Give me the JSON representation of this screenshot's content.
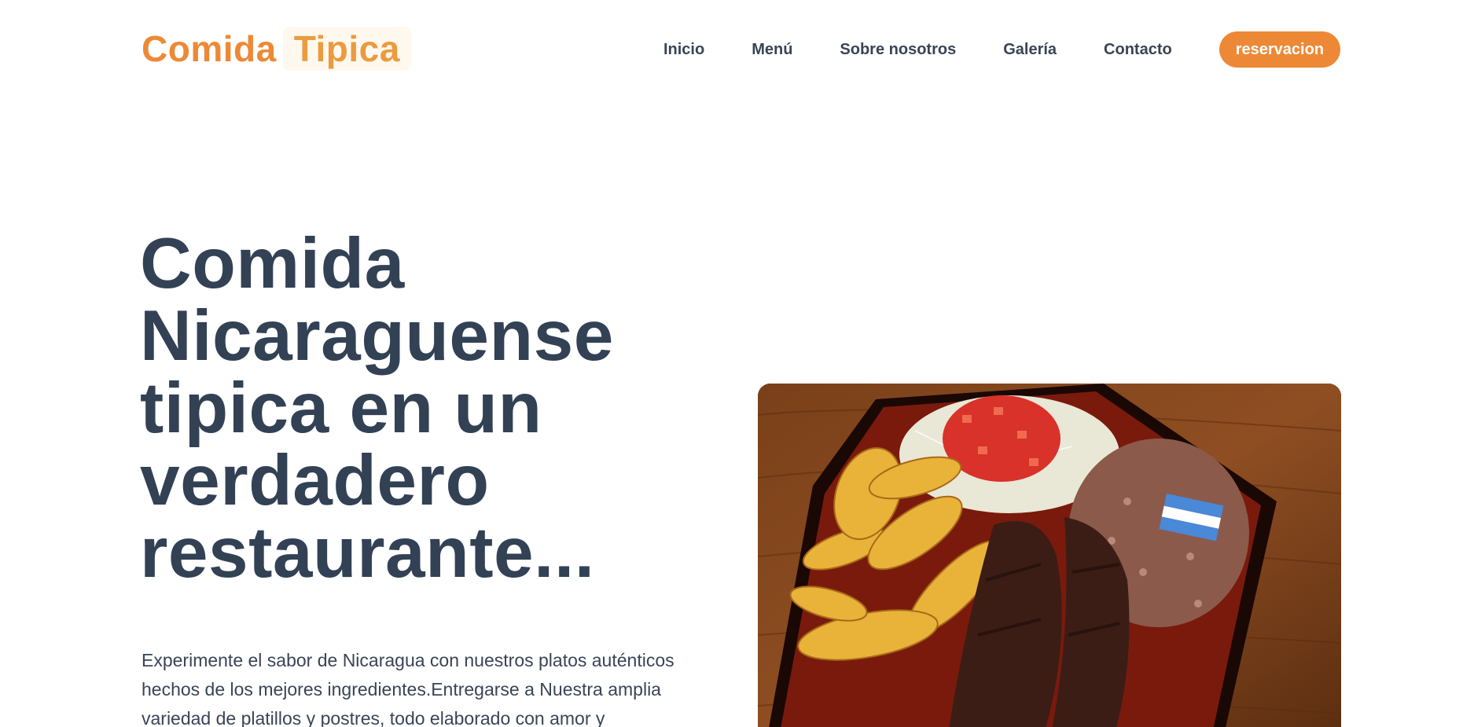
{
  "header": {
    "logo_part1": "Comida",
    "logo_part2": "Tipica",
    "nav": [
      "Inicio",
      "Menú",
      "Sobre nosotros",
      "Galería",
      "Contacto"
    ],
    "cta_label": "reservacion"
  },
  "hero": {
    "title": "Comida Nicaraguense tipica en un verdadero restaurante...",
    "description": "Experimente el sabor de Nicaragua con nuestros platos auténticos hechos de los mejores ingredientes.Entregarse a Nuestra amplia variedad de platillos y postres, todo elaborado con amor y"
  },
  "colors": {
    "accent": "#ed8936",
    "text": "#334155"
  }
}
